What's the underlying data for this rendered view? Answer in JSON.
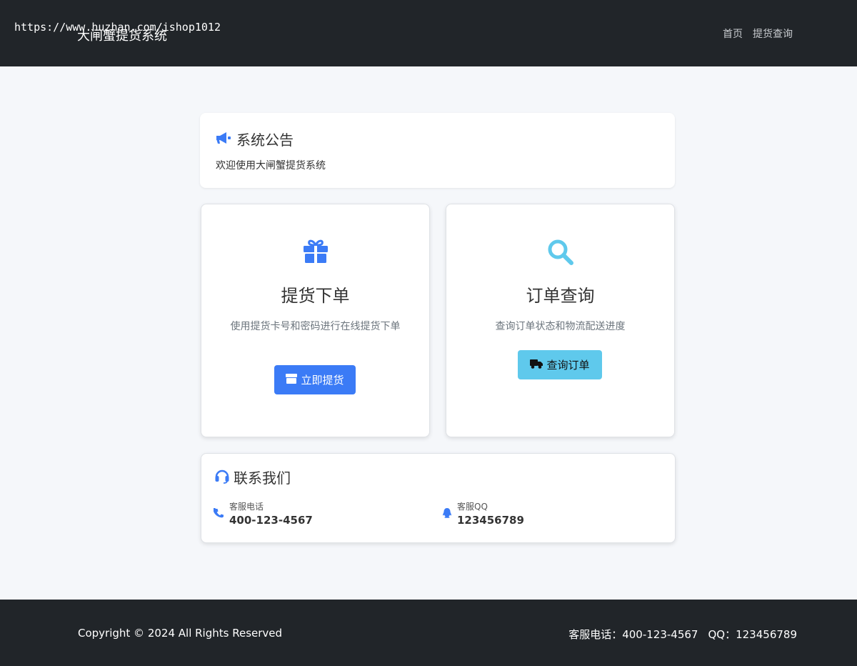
{
  "navbar": {
    "url_text": "https://www.huzhan.com/ishop1012",
    "brand": "大闸蟹提货系统",
    "links": [
      "首页",
      "提货查询"
    ]
  },
  "notice": {
    "icon": "megaphone-icon",
    "title": "系统公告",
    "text": "欢迎使用大闸蟹提货系统"
  },
  "features": {
    "pickup": {
      "icon": "gift-icon",
      "title": "提货下单",
      "desc": "使用提货卡号和密码进行在线提货下单",
      "button_icon": "box-icon",
      "button_label": "立即提货"
    },
    "query": {
      "icon": "search-icon",
      "title": "订单查询",
      "desc": "查询订单状态和物流配送进度",
      "button_icon": "truck-icon",
      "button_label": "查询订单"
    }
  },
  "contact": {
    "icon": "headset-icon",
    "title": "联系我们",
    "phone_label": "客服电话",
    "phone_value": "400-123-4567",
    "qq_label": "客服QQ",
    "qq_value": "123456789"
  },
  "footer": {
    "copyright": "Copyright © 2024 All Rights Reserved",
    "phone": "客服电话：400-123-4567",
    "qq": "QQ：123456789"
  },
  "colors": {
    "primary": "#3b7bf6",
    "info": "#5fc9ec",
    "dark": "#212529",
    "background": "#f5f7fa"
  }
}
